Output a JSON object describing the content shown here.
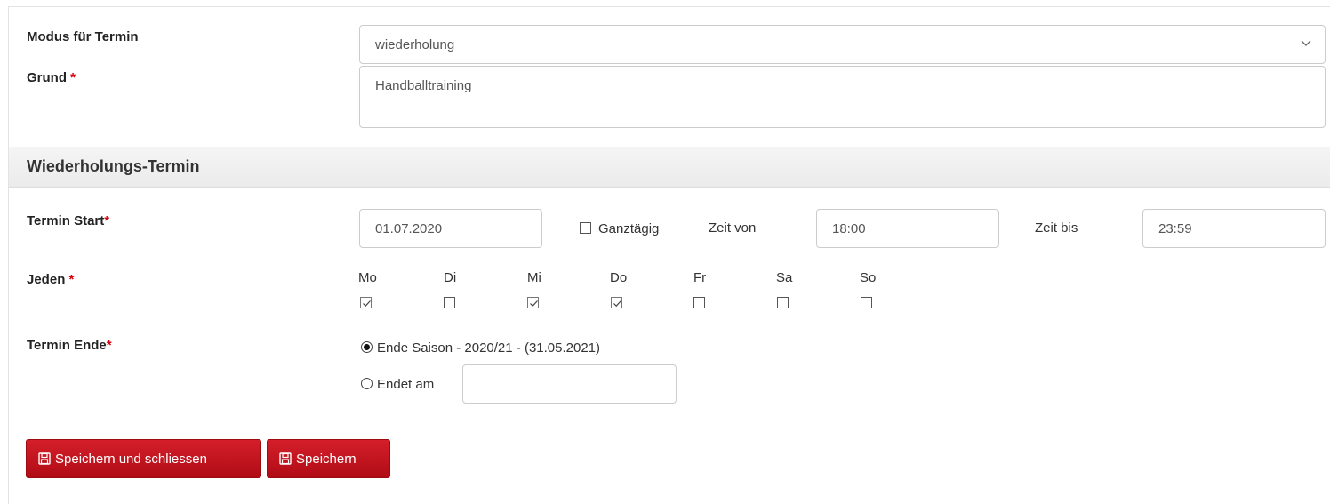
{
  "form": {
    "modus_label": "Modus für Termin",
    "modus_value": "wiederholung",
    "grund_label": "Grund",
    "grund_value": "Handballtraining",
    "required_mark": "*"
  },
  "section": {
    "title": "Wiederholungs-Termin"
  },
  "start": {
    "label": "Termin Start",
    "date_value": "01.07.2020",
    "allday_label": "Ganztägig",
    "allday_checked": false,
    "time_from_label": "Zeit von",
    "time_from_value": "18:00",
    "time_to_label": "Zeit bis",
    "time_to_value": "23:59"
  },
  "jeden": {
    "label": "Jeden",
    "days": [
      {
        "label": "Mo",
        "checked": true
      },
      {
        "label": "Di",
        "checked": false
      },
      {
        "label": "Mi",
        "checked": true
      },
      {
        "label": "Do",
        "checked": true
      },
      {
        "label": "Fr",
        "checked": false
      },
      {
        "label": "Sa",
        "checked": false
      },
      {
        "label": "So",
        "checked": false
      }
    ]
  },
  "ende": {
    "label": "Termin Ende",
    "option_season": "Ende Saison - 2020/21 - (31.05.2021)",
    "option_date": "Endet am",
    "selected": "season",
    "date_value": ""
  },
  "buttons": {
    "save_close": "Speichern und schliessen",
    "save": "Speichern"
  },
  "icons": {
    "select_chevron": "chevron-down-icon",
    "save": "floppy-disk-icon"
  },
  "colors": {
    "primary_button": "#c8141e",
    "required": "#d9000d",
    "section_bg": "#f0f0f0"
  }
}
